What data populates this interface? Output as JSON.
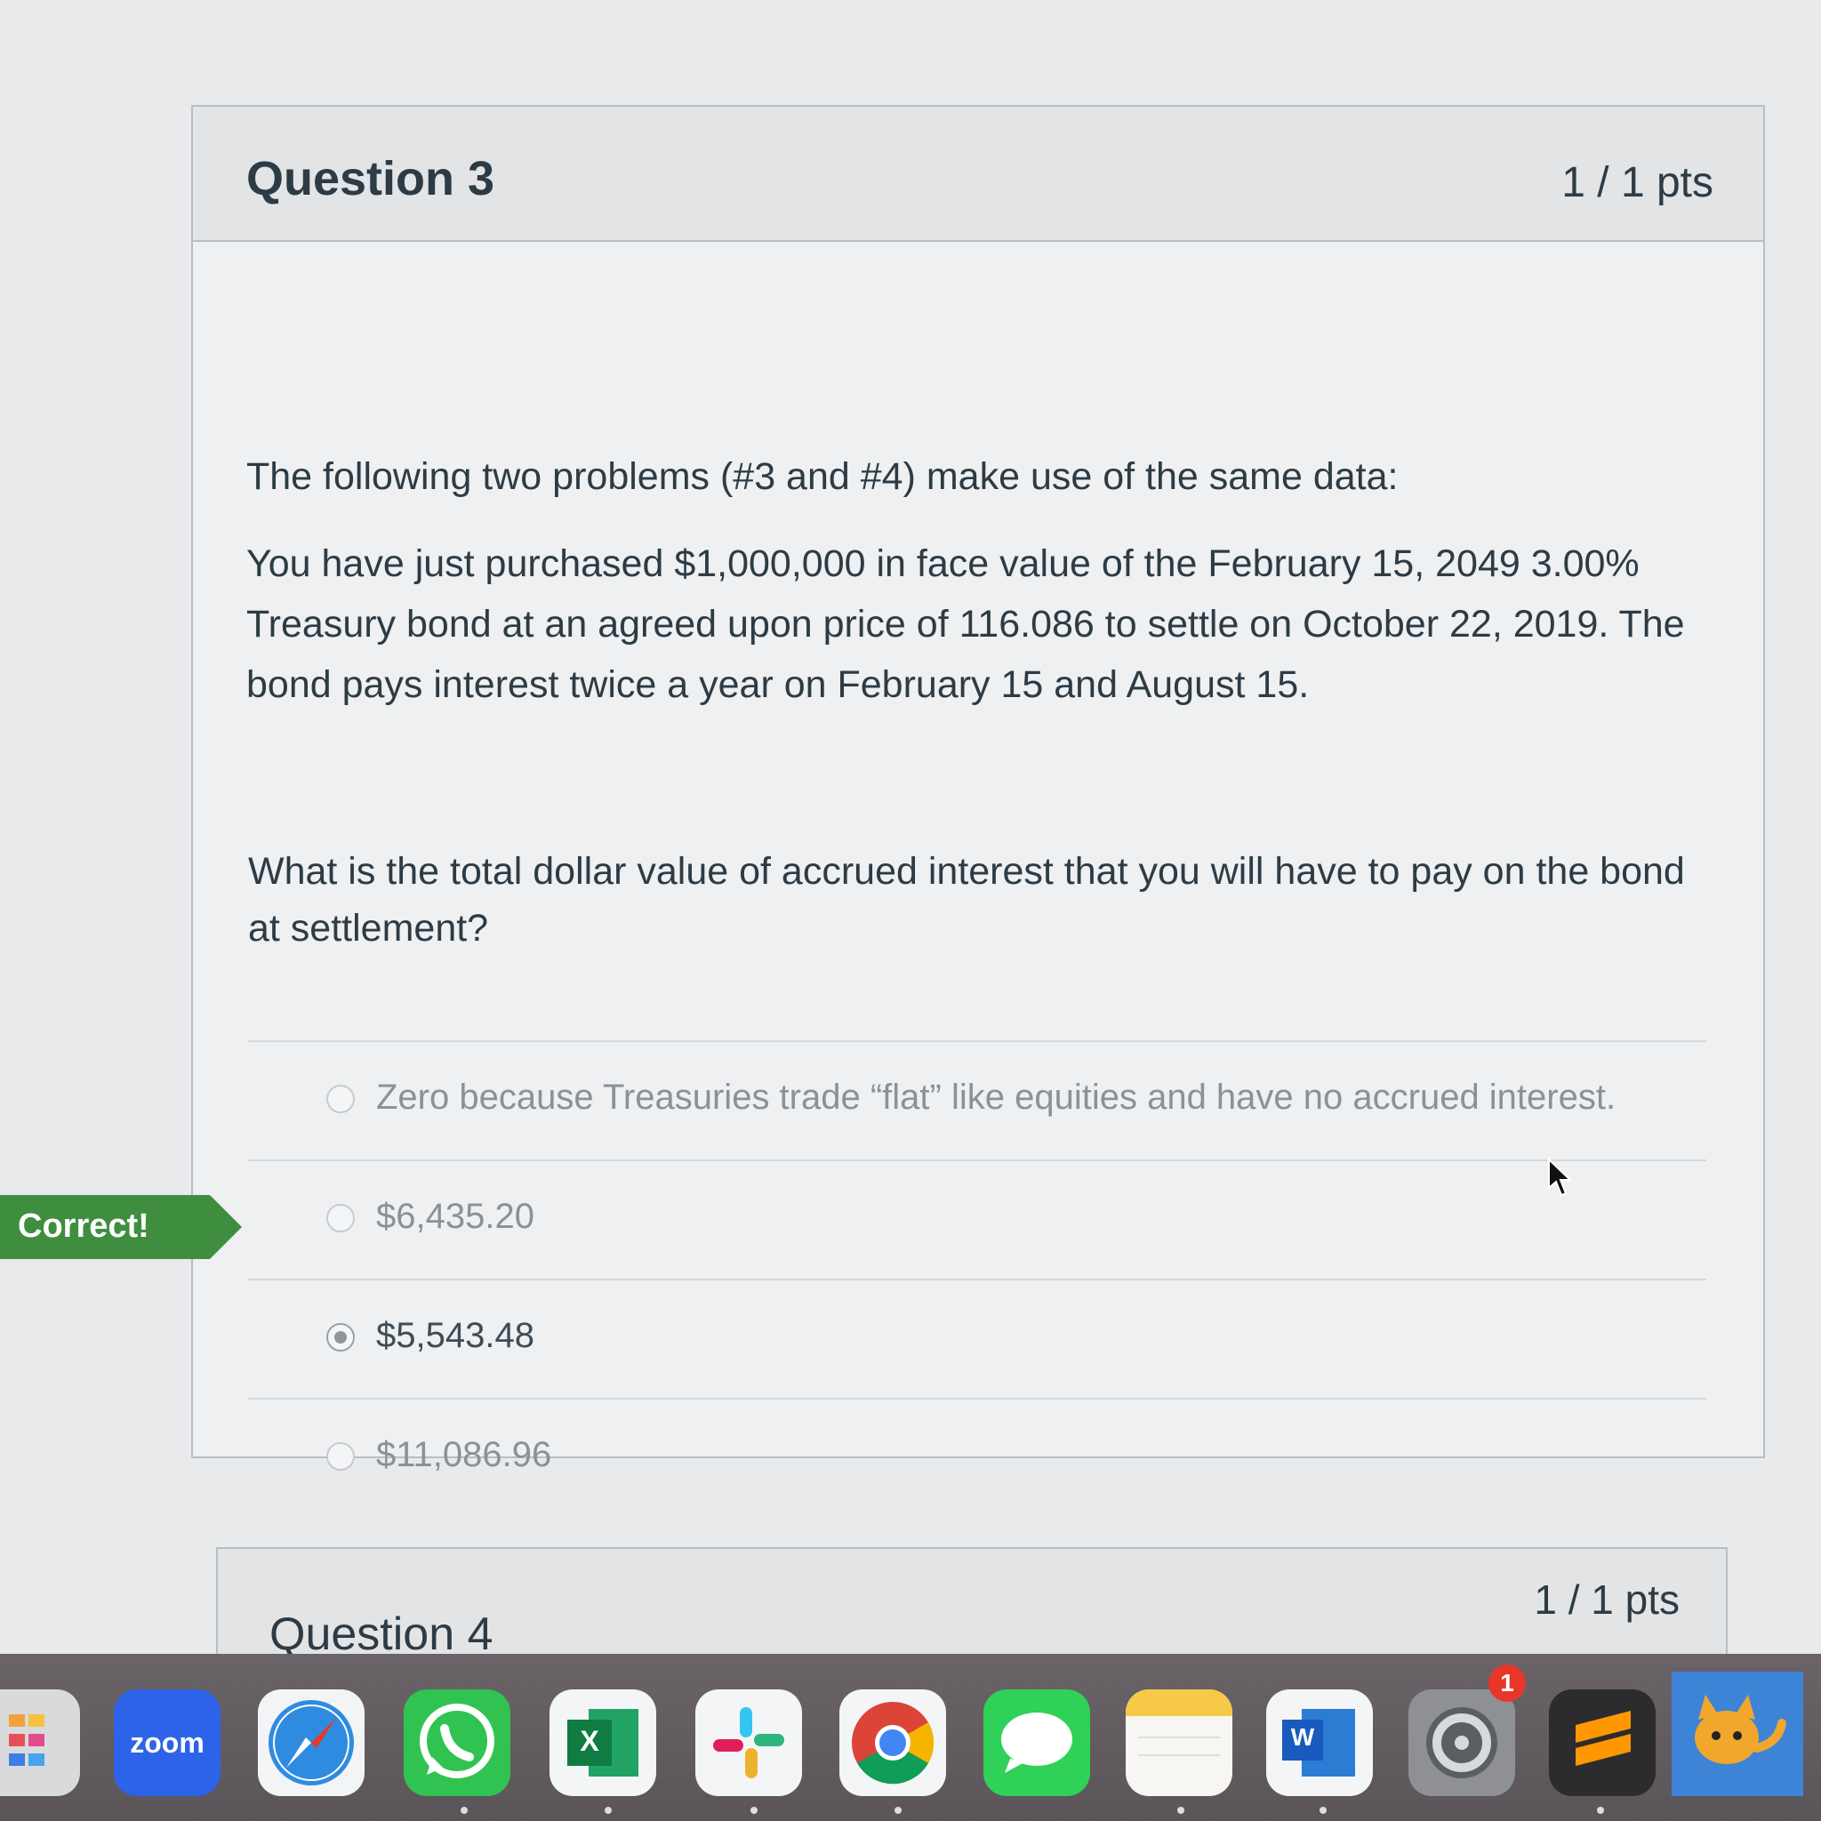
{
  "question3": {
    "title": "Question 3",
    "points": "1 / 1 pts",
    "intro": "The following two problems (#3 and #4) make use of the same data:",
    "passage": "You have just purchased $1,000,000 in face value of the February 15, 2049 3.00% Treasury bond at an agreed upon price of 116.086 to settle on October 22, 2019. The bond pays interest twice a year on February 15 and August 15.",
    "prompt": "What is the total dollar value of accrued interest that you will have to pay on the bond at settlement?",
    "answers": [
      {
        "label": "Zero because Treasuries trade “flat” like equities and have no accrued interest.",
        "selected": false
      },
      {
        "label": "$6,435.20",
        "selected": false
      },
      {
        "label": "$5,543.48",
        "selected": true
      },
      {
        "label": "$11,086.96",
        "selected": false
      }
    ],
    "result_flag": "Correct!"
  },
  "question4": {
    "title": "Question 4",
    "points": "1 / 1 pts"
  },
  "dock": {
    "zoom_label": "zoom",
    "excel_letter": "X",
    "word_letter": "W",
    "settings_badge": "1"
  },
  "colors": {
    "correct_flag": "#3f8e3f",
    "badge": "#e8362b"
  }
}
